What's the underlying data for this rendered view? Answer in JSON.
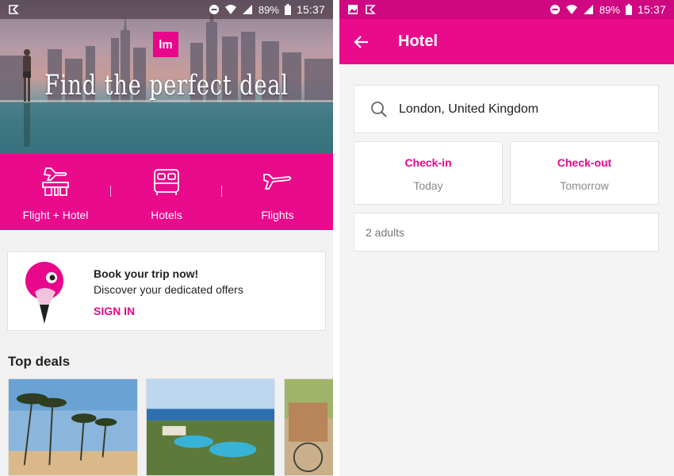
{
  "left_screen": {
    "statusbar": {
      "battery": "89%",
      "time": "15:37"
    },
    "hero": {
      "logo_text": "lm",
      "title": "Find the perfect deal"
    },
    "categories": [
      {
        "label": "Flight + Hotel",
        "icon": "flight-hotel-icon"
      },
      {
        "label": "Hotels",
        "icon": "bed-icon"
      },
      {
        "label": "Flights",
        "icon": "airplane-icon"
      }
    ],
    "signin_card": {
      "title": "Book your trip now!",
      "subtitle": "Discover your dedicated offers",
      "link": "SIGN IN"
    },
    "section_title": "Top deals"
  },
  "right_screen": {
    "statusbar": {
      "battery": "89%",
      "time": "15:37"
    },
    "appbar": {
      "title": "Hotel"
    },
    "destination": "London, United Kingdom",
    "checkin": {
      "label": "Check-in",
      "value": "Today"
    },
    "checkout": {
      "label": "Check-out",
      "value": "Tomorrow"
    },
    "guests": "2 adults"
  },
  "colors": {
    "brand_pink": "#ea0a8c",
    "status_pink": "#cf0781"
  }
}
